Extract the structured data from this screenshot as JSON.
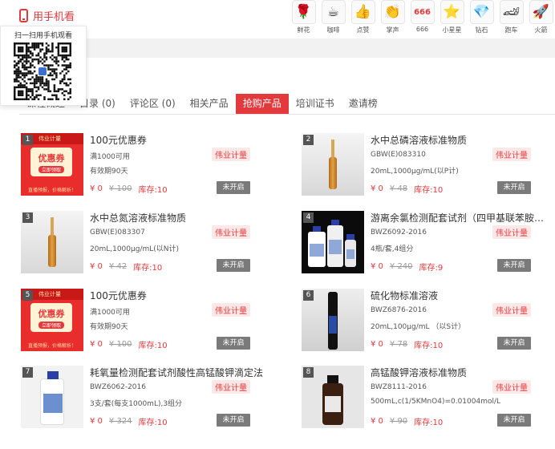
{
  "top": {
    "mobile_label": "用手机看",
    "qr_title": "扫一扫用手机观看"
  },
  "gifts": [
    {
      "icon": "rose-icon",
      "glyph": "🌹",
      "label": "鲜花"
    },
    {
      "icon": "coffee-icon",
      "glyph": "☕",
      "label": "咖啡"
    },
    {
      "icon": "thumbs-up-icon",
      "glyph": "👍",
      "label": "点赞"
    },
    {
      "icon": "applause-icon",
      "glyph": "👏",
      "label": "掌声"
    },
    {
      "icon": "six-six-six-icon",
      "glyph": "666",
      "label": "666"
    },
    {
      "icon": "little-star-icon",
      "glyph": "⭐",
      "label": "小星星"
    },
    {
      "icon": "diamond-icon",
      "glyph": "💎",
      "label": "钻石"
    },
    {
      "icon": "sports-car-icon",
      "glyph": "🏎",
      "label": "跑车"
    },
    {
      "icon": "rocket-icon",
      "glyph": "🚀",
      "label": "火箭"
    }
  ],
  "tabs": [
    {
      "label": "课程概述"
    },
    {
      "label": "目录 (0)"
    },
    {
      "label": "评论区 (0)"
    },
    {
      "label": "相关产品"
    },
    {
      "label": "抢购产品",
      "active": true
    },
    {
      "label": "培训证书"
    },
    {
      "label": "邀请榜"
    }
  ],
  "coupon_art": {
    "brand": "伟业计量",
    "ticket": "优惠券",
    "button": "立即领取",
    "footer": "直播预报，价格解析！"
  },
  "products": [
    {
      "index": "1",
      "title": "100元优惠券",
      "spec1": "满1000可用",
      "spec2": "有效期90天",
      "badge": "伟业计量",
      "price": "¥ 0",
      "old_price": "¥ 100",
      "stock": "库存:10",
      "status": "未开启",
      "thumb": "coupon"
    },
    {
      "index": "2",
      "title": "水中总磷溶液标准物质",
      "spec1": "GBW(E)083310",
      "spec2": "20mL,1000μg/mL(以P计)",
      "badge": "伟业计量",
      "price": "¥ 0",
      "old_price": "¥ 48",
      "stock": "库存:10",
      "status": "未开启",
      "thumb": "ampoule"
    },
    {
      "index": "3",
      "title": "水中总氮溶液标准物质",
      "spec1": "GBW(E)083307",
      "spec2": "20mL,1000μg/mL(以N计)",
      "badge": "伟业计量",
      "price": "¥ 0",
      "old_price": "¥ 42",
      "stock": "库存:10",
      "status": "未开启",
      "thumb": "ampoule"
    },
    {
      "index": "4",
      "title": "游离余氯检测配套试剂（四甲基联苯胺法）",
      "spec1": "BWZ6092-2016",
      "spec2": "4瓶/套,4组分",
      "badge": "伟业计量",
      "price": "¥ 0",
      "old_price": "¥ 240",
      "stock": "库存:9",
      "status": "未开启",
      "thumb": "kit"
    },
    {
      "index": "5",
      "title": "100元优惠券",
      "spec1": "满1000可用",
      "spec2": "有效期90天",
      "badge": "伟业计量",
      "price": "¥ 0",
      "old_price": "¥ 100",
      "stock": "库存:10",
      "status": "未开启",
      "thumb": "coupon"
    },
    {
      "index": "6",
      "title": "硫化物标准溶液",
      "spec1": "BWZ6876-2016",
      "spec2": "20mL,100μg/mL （以S计）",
      "badge": "伟业计量",
      "price": "¥ 0",
      "old_price": "¥ 78",
      "stock": "库存:10",
      "status": "未开启",
      "thumb": "tube"
    },
    {
      "index": "7",
      "title": "耗氧量检测配套试剂酸性高锰酸钾滴定法",
      "spec1": "BWZ6062-2016",
      "spec2": "3支/套(每支1000mL),3组分",
      "badge": "伟业计量",
      "price": "¥ 0",
      "old_price": "¥ 324",
      "stock": "库存:10",
      "status": "未开启",
      "thumb": "bottle-white"
    },
    {
      "index": "8",
      "title": "高锰酸钾溶液标准物质",
      "spec1": "BWZ8111-2016",
      "spec2": "500mL,c(1/5KMnO4)=0.01004mol/L",
      "badge": "伟业计量",
      "price": "¥ 0",
      "old_price": "¥ 90",
      "stock": "库存:10",
      "status": "未开启",
      "thumb": "bottle-brown"
    }
  ]
}
